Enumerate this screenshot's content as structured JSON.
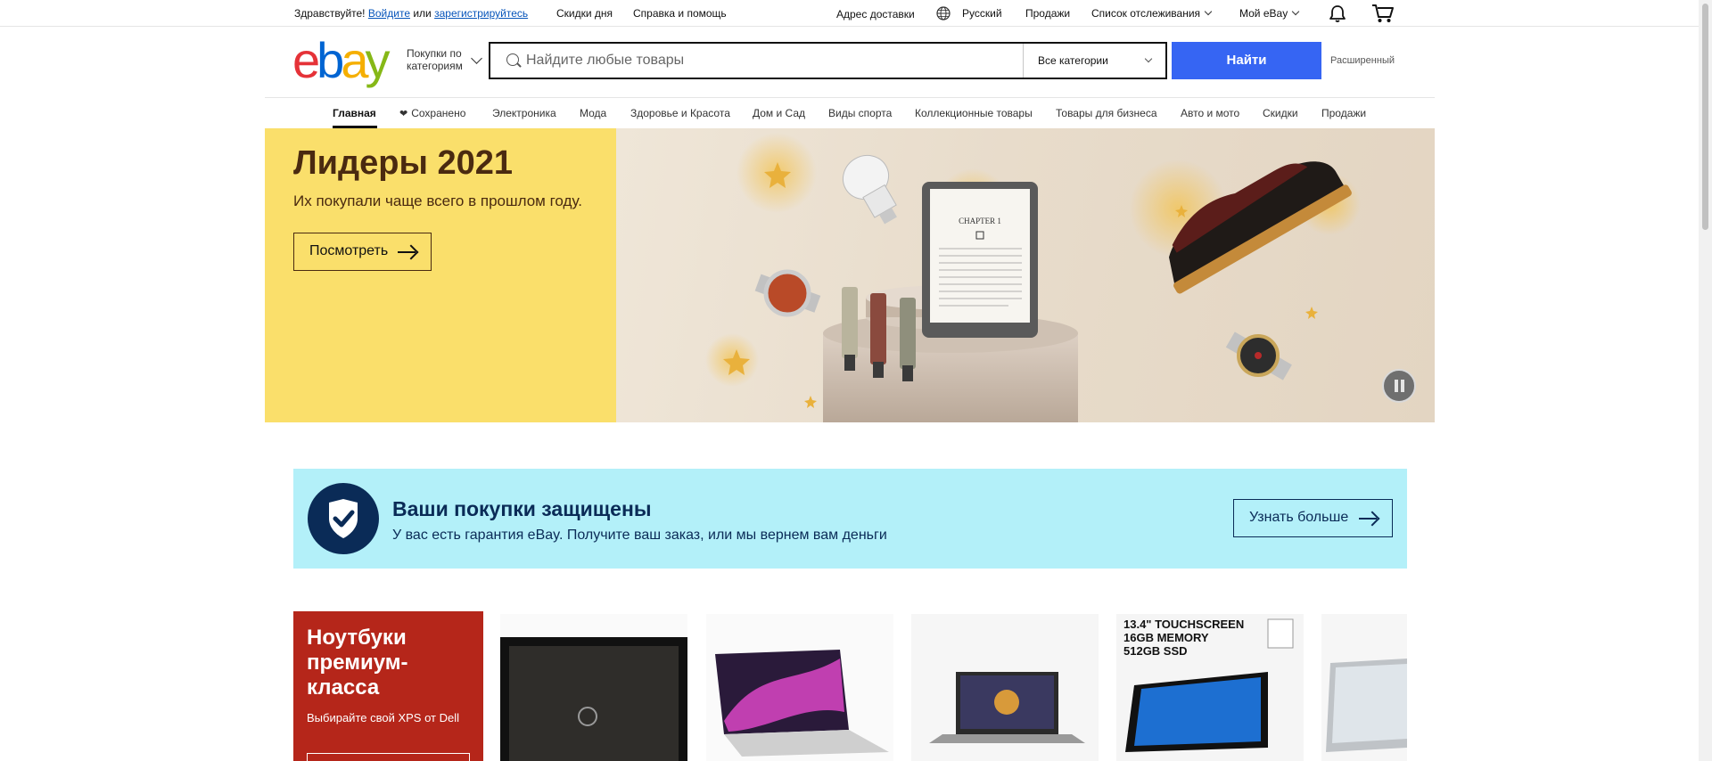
{
  "topbar": {
    "greeting": "Здравствуйте!",
    "signin": "Войдите",
    "or": "или",
    "register": "зарегистрируйтесь",
    "daily_deals": "Скидки дня",
    "help": "Справка и помощь",
    "ship_to": "Адрес доставки",
    "language": "Русский",
    "sell": "Продажи",
    "watchlist": "Список отслеживания",
    "my_ebay": "Мой eBay"
  },
  "header": {
    "logo_letters": [
      "e",
      "b",
      "a",
      "y"
    ],
    "logo_colors": [
      "#e53238",
      "#0064d2",
      "#f5af02",
      "#86b817"
    ],
    "shop_by_category": "Покупки по категориям",
    "search_placeholder": "Найдите любые товары",
    "category_select": "Все категории",
    "search_button": "Найти",
    "advanced": "Расширенный"
  },
  "nav": {
    "items": [
      "Главная",
      "Сохранено",
      "Электроника",
      "Мода",
      "Здоровье и Красота",
      "Дом и Сад",
      "Виды спорта",
      "Коллекционные товары",
      "Товары для бизнеса",
      "Авто и мото",
      "Скидки",
      "Продажи"
    ]
  },
  "hero": {
    "title": "Лидеры 2021",
    "subtitle": "Их покупали чаще всего в прошлом году.",
    "button": "Посмотреть",
    "bg_color": "#fadf6b",
    "ereader_title": "CHAPTER 1"
  },
  "protection": {
    "title": "Ваши покупки защищены",
    "subtitle": "У вас есть гарантия eBay. Получите ваш заказ, или мы вернем вам деньги",
    "button": "Узнать больше",
    "bg_color": "#b3f0f9"
  },
  "laptops": {
    "title": "Ноутбуки премиум-класса",
    "subtitle": "Выбирайте свой XPS от Dell",
    "bg_color": "#b5261a",
    "tile_text": [
      "13.4\" TOUCHSCREEN",
      "16GB MEMORY",
      "512GB SSD"
    ]
  },
  "icons": {
    "globe": "globe-icon",
    "bell": "bell-icon",
    "cart": "cart-icon",
    "search": "search-icon",
    "heart": "heart-icon",
    "pause": "pause-icon",
    "shield": "shield-check-icon"
  }
}
